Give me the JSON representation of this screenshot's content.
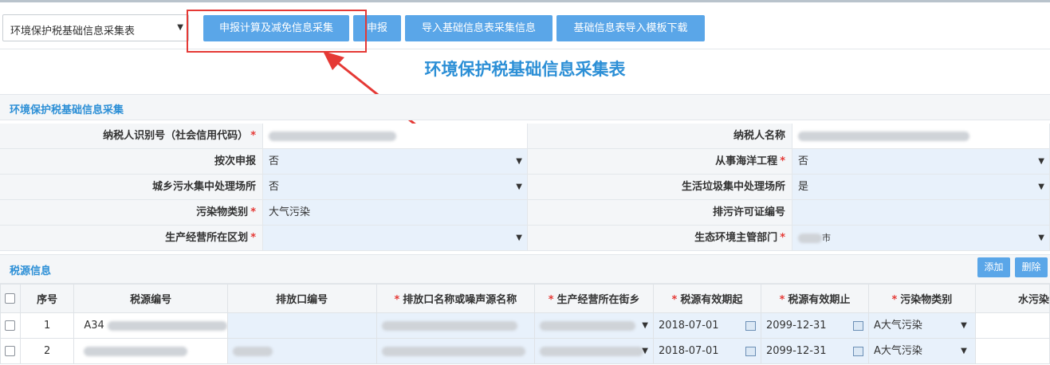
{
  "toolbar": {
    "form_select": "环境保护税基础信息采集表",
    "btn_collect": "申报计算及减免信息采集",
    "btn_declare": "申报",
    "btn_import": "导入基础信息表采集信息",
    "btn_template": "基础信息表导入模板下载"
  },
  "page_title": "环境保护税基础信息采集表",
  "section_basic": "环境保护税基础信息采集",
  "fields": {
    "taxpayer_id_label": "纳税人识别号（社会信用代码）",
    "taxpayer_name_label": "纳税人名称",
    "by_times_label": "按次申报",
    "by_times_value": "否",
    "marine_label": "从事海洋工程",
    "marine_value": "否",
    "sewage_label": "城乡污水集中处理场所",
    "sewage_value": "否",
    "garbage_label": "生活垃圾集中处理场所",
    "garbage_value": "是",
    "pollutant_label": "污染物类别",
    "pollutant_value": "大气污染",
    "permit_label": "排污许可证编号",
    "district_label": "生产经营所在区划",
    "eco_dept_label": "生态环境主管部门",
    "eco_dept_suffix": "市"
  },
  "section_source": "税源信息",
  "source_buttons": {
    "add": "添加",
    "delete": "删除"
  },
  "table": {
    "headers": {
      "seq": "序号",
      "source_no": "税源编号",
      "outlet_no": "排放口编号",
      "outlet_name": "排放口名称或噪声源名称",
      "street": "生产经营所在街乡",
      "valid_from": "税源有效期起",
      "valid_to": "税源有效期止",
      "pollutant_type": "污染物类别",
      "water": "水污染"
    },
    "rows": [
      {
        "seq": "1",
        "source_no": "A34",
        "valid_from": "2018-07-01",
        "valid_to": "2099-12-31",
        "pollutant": "A大气污染"
      },
      {
        "seq": "2",
        "source_no": "",
        "valid_from": "2018-07-01",
        "valid_to": "2099-12-31",
        "pollutant": "A大气污染"
      }
    ]
  },
  "colors": {
    "accent": "#2c8fd6",
    "button": "#5aa6e8",
    "highlight": "#e53935"
  }
}
